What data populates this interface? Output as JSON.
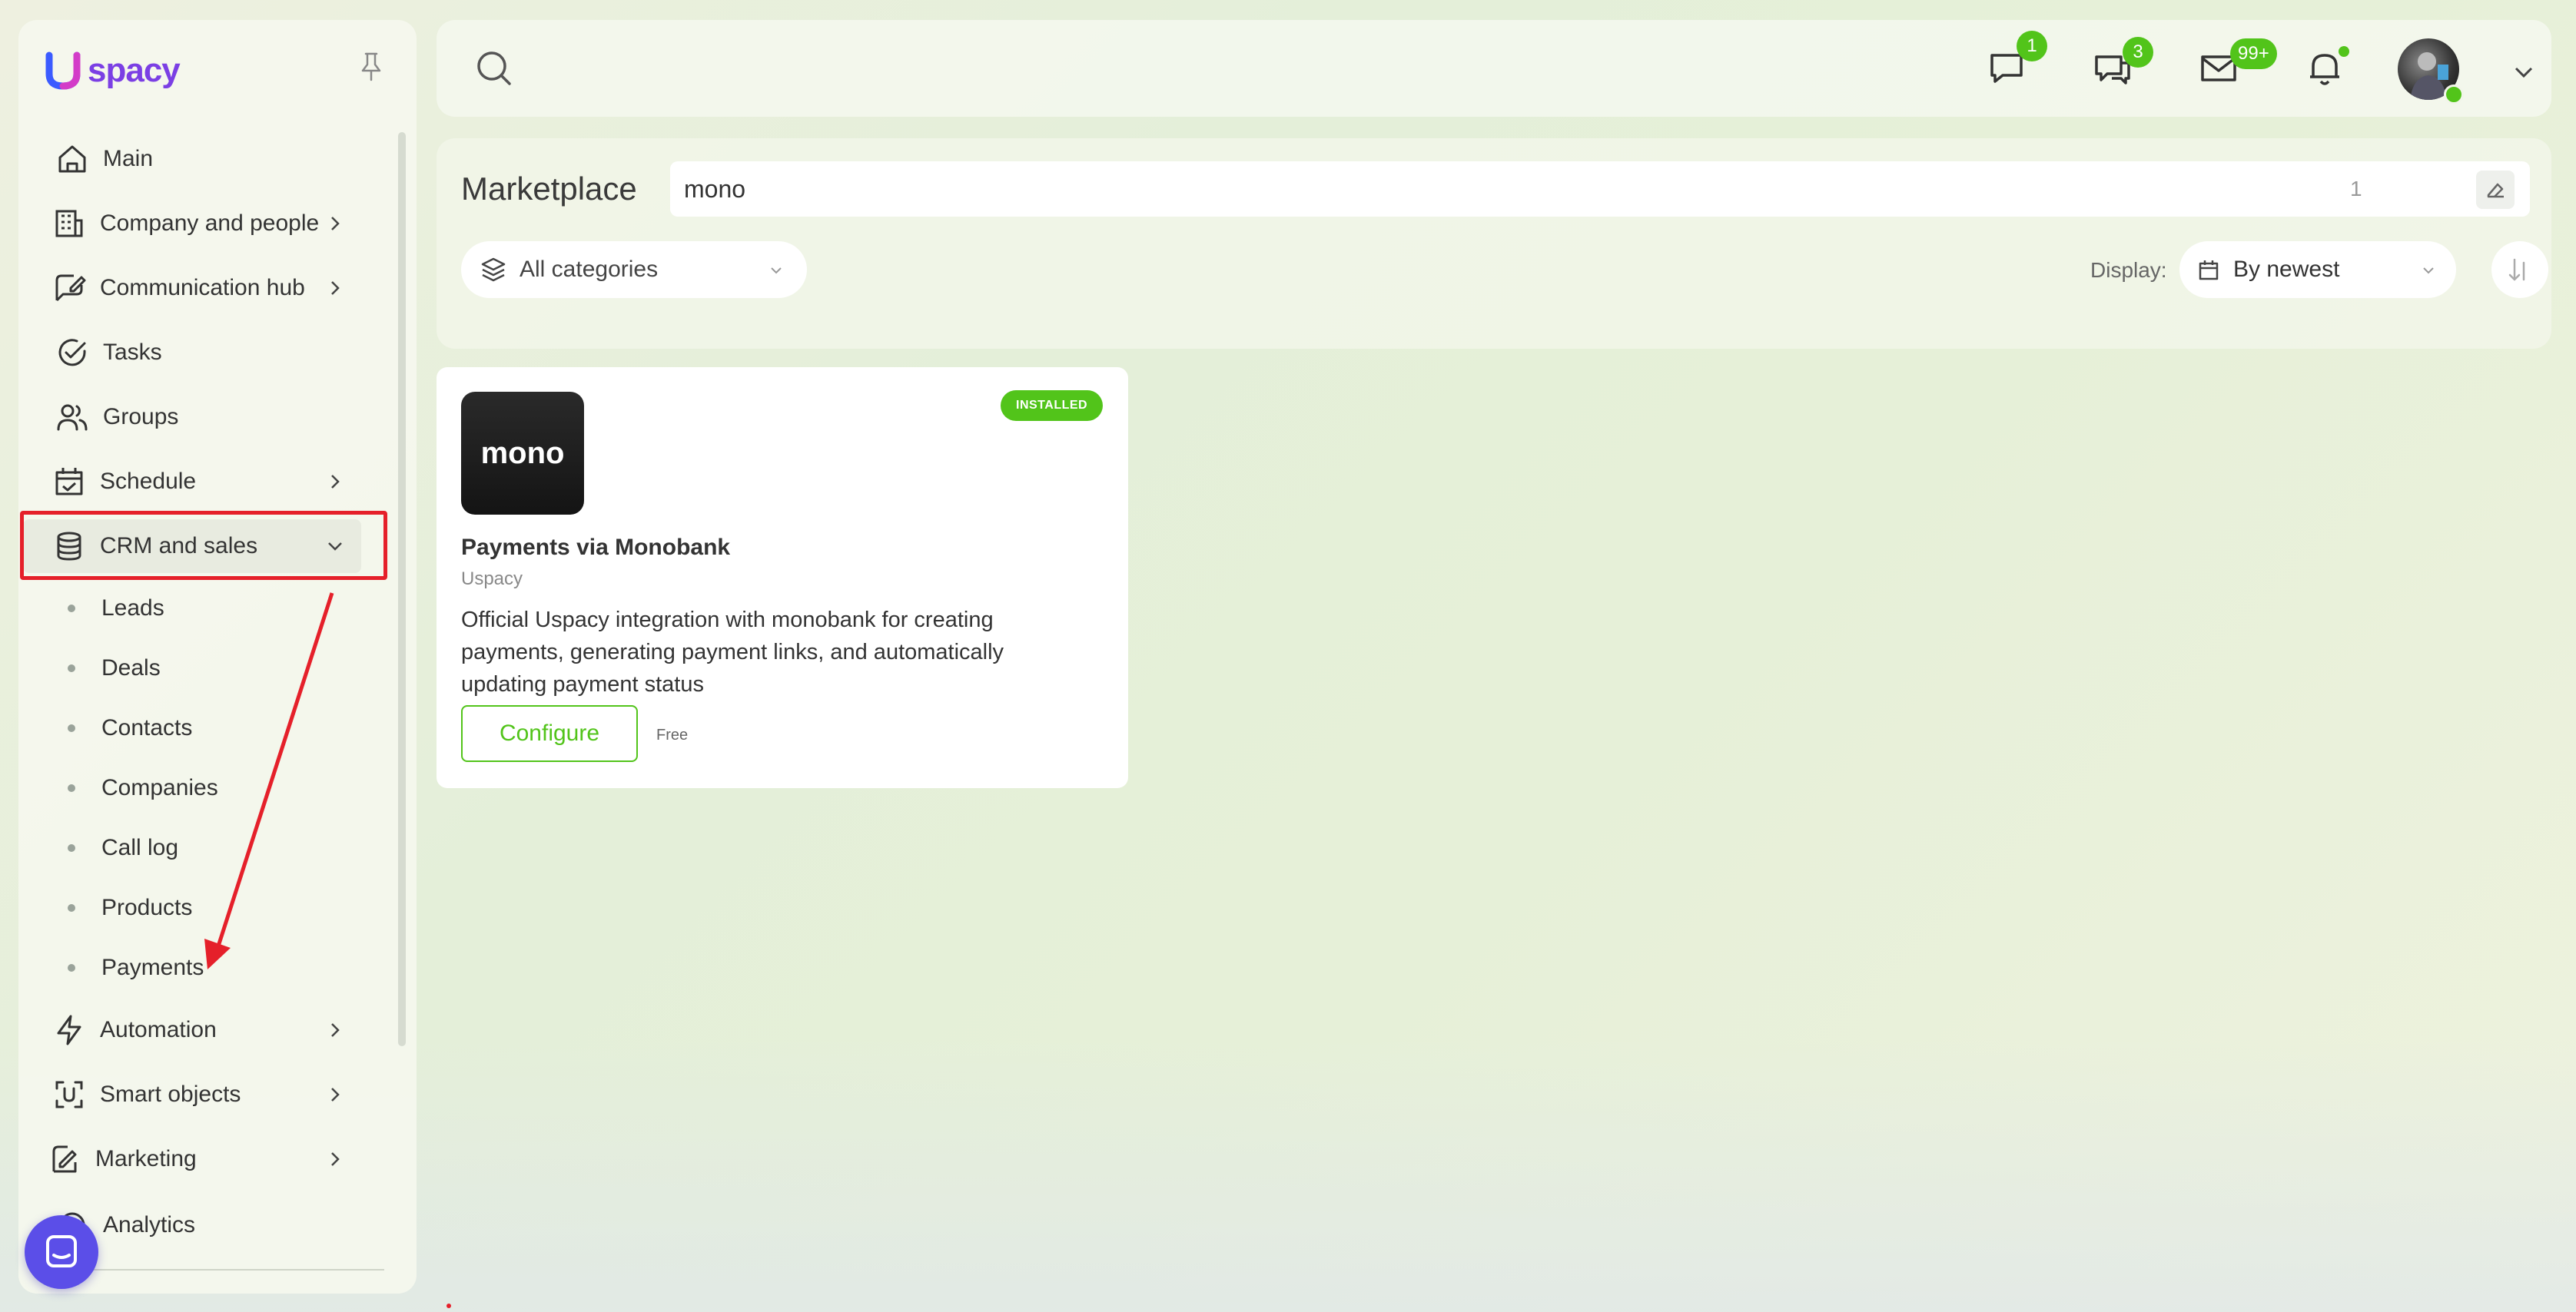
{
  "brand": {
    "logo_text": "spacy"
  },
  "sidebar": {
    "items": [
      {
        "label": "Main",
        "icon": "home-icon"
      },
      {
        "label": "Company and people",
        "icon": "building-icon"
      },
      {
        "label": "Communication hub",
        "icon": "chat-edit-icon"
      },
      {
        "label": "Tasks",
        "icon": "check-circle-icon"
      },
      {
        "label": "Groups",
        "icon": "users-icon"
      },
      {
        "label": "Schedule",
        "icon": "calendar-icon"
      },
      {
        "label": "CRM and sales",
        "icon": "database-icon"
      },
      {
        "label": "Automation",
        "icon": "lightning-icon"
      },
      {
        "label": "Smart objects",
        "icon": "scan-icon"
      },
      {
        "label": "Marketing",
        "icon": "megaphone-icon"
      },
      {
        "label": "Analytics",
        "icon": "chart-icon"
      }
    ],
    "crm_subitems": [
      "Leads",
      "Deals",
      "Contacts",
      "Companies",
      "Call log",
      "Products",
      "Payments"
    ]
  },
  "topbar": {
    "chat_badge": "1",
    "discussions_badge": "3",
    "mail_badge": "99+"
  },
  "marketplace": {
    "title": "Marketplace",
    "search_value": "mono",
    "result_count": "1",
    "category": "All categories",
    "display_label": "Display:",
    "sort": "By newest"
  },
  "app": {
    "logo_text": "mono",
    "status": "INSTALLED",
    "name": "Payments via Monobank",
    "vendor": "Uspacy",
    "description": "Official Uspacy integration with monobank for creating payments, generating payment links, and automatically updating payment status",
    "configure_label": "Configure",
    "price": "Free"
  },
  "colors": {
    "accent": "#52c41a",
    "brand": "#7b3fe4",
    "highlight": "#e5202a"
  }
}
